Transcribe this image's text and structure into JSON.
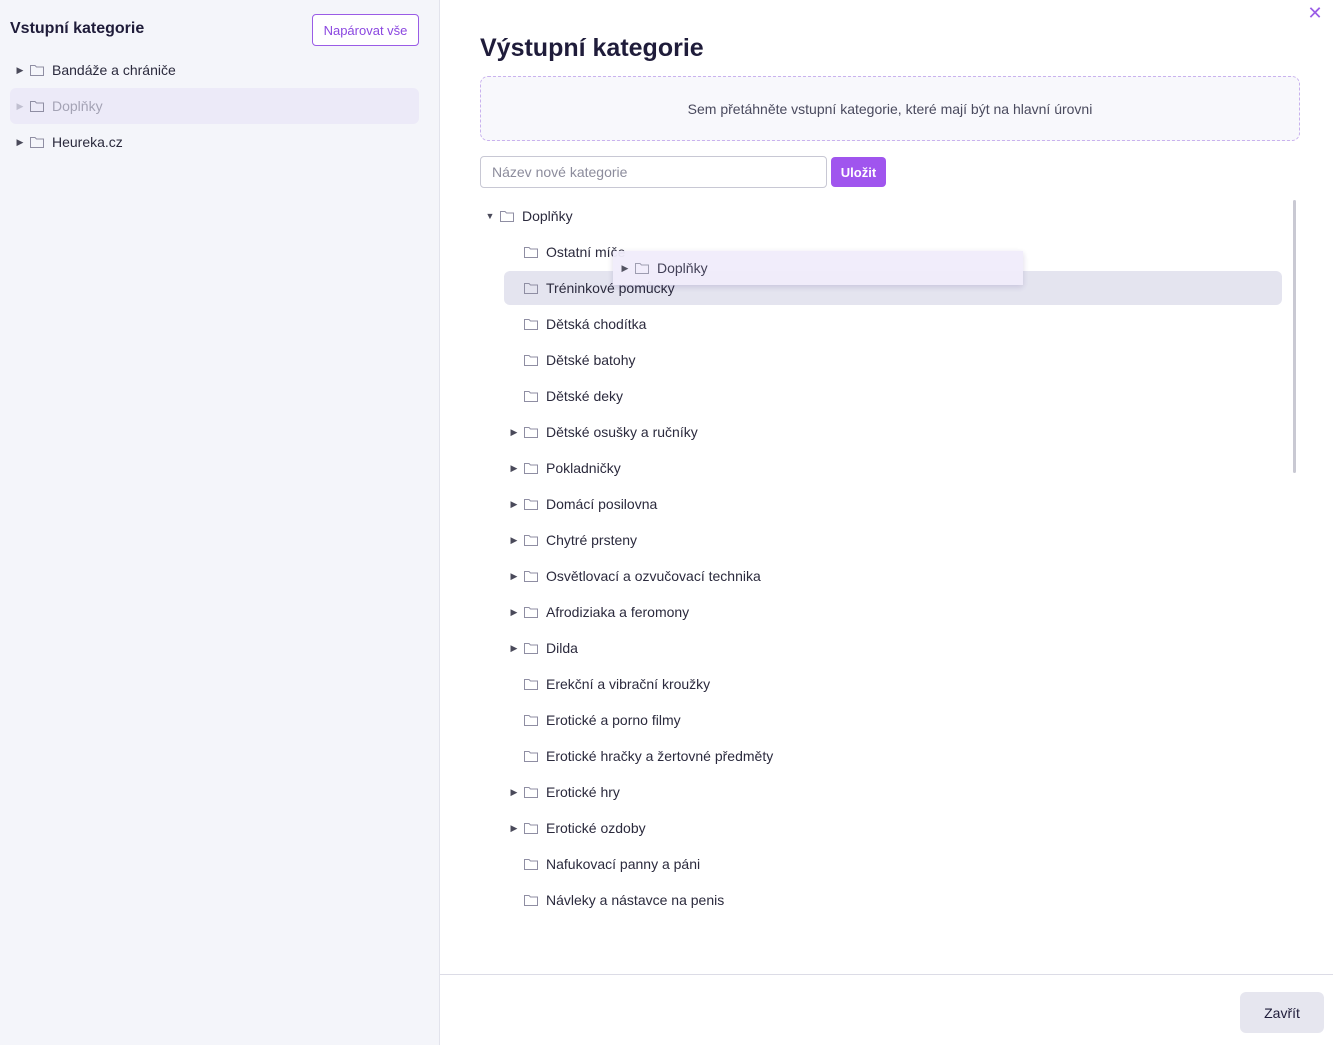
{
  "left": {
    "title": "Vstupní kategorie",
    "pair_all_label": "Napárovat vše",
    "items": [
      {
        "label": "Bandáže a chrániče",
        "expandable": true
      },
      {
        "label": "Doplňky",
        "expandable": true,
        "state": "dragging-source"
      },
      {
        "label": "Heureka.cz",
        "expandable": true
      }
    ]
  },
  "right": {
    "title": "Výstupní kategorie",
    "drop_zone_text": "Sem přetáhněte vstupní kategorie, které mají být na hlavní úrovni",
    "new_category_placeholder": "Název nové kategorie",
    "save_label": "Uložit",
    "tree": {
      "root": {
        "label": "Doplňky",
        "expanded": true
      },
      "children": [
        {
          "label": "Ostatní míče",
          "expandable": false
        },
        {
          "label": "Tréninkové pomůcky",
          "expandable": false,
          "state": "drop-target"
        },
        {
          "label": "Dětská chodítka",
          "expandable": false
        },
        {
          "label": "Dětské batohy",
          "expandable": false
        },
        {
          "label": "Dětské deky",
          "expandable": false
        },
        {
          "label": "Dětské osušky a ručníky",
          "expandable": true
        },
        {
          "label": "Pokladničky",
          "expandable": true
        },
        {
          "label": "Domácí posilovna",
          "expandable": true
        },
        {
          "label": "Chytré prsteny",
          "expandable": true
        },
        {
          "label": "Osvětlovací a ozvučovací technika",
          "expandable": true
        },
        {
          "label": "Afrodiziaka a feromony",
          "expandable": true
        },
        {
          "label": "Dilda",
          "expandable": true
        },
        {
          "label": "Erekční a vibrační kroužky",
          "expandable": false
        },
        {
          "label": "Erotické a porno filmy",
          "expandable": false
        },
        {
          "label": "Erotické hračky a žertovné předměty",
          "expandable": false
        },
        {
          "label": "Erotické hry",
          "expandable": true
        },
        {
          "label": "Erotické ozdoby",
          "expandable": true
        },
        {
          "label": "Nafukovací panny a páni",
          "expandable": false
        },
        {
          "label": "Návleky a nástavce na penis",
          "expandable": false
        }
      ]
    },
    "drag_ghost_label": "Doplňky"
  },
  "footer": {
    "close_label": "Zavřít"
  },
  "colors": {
    "accent": "#a055ee",
    "left_bg": "#f4f5fa",
    "highlight_row": "#e4e4ef"
  }
}
